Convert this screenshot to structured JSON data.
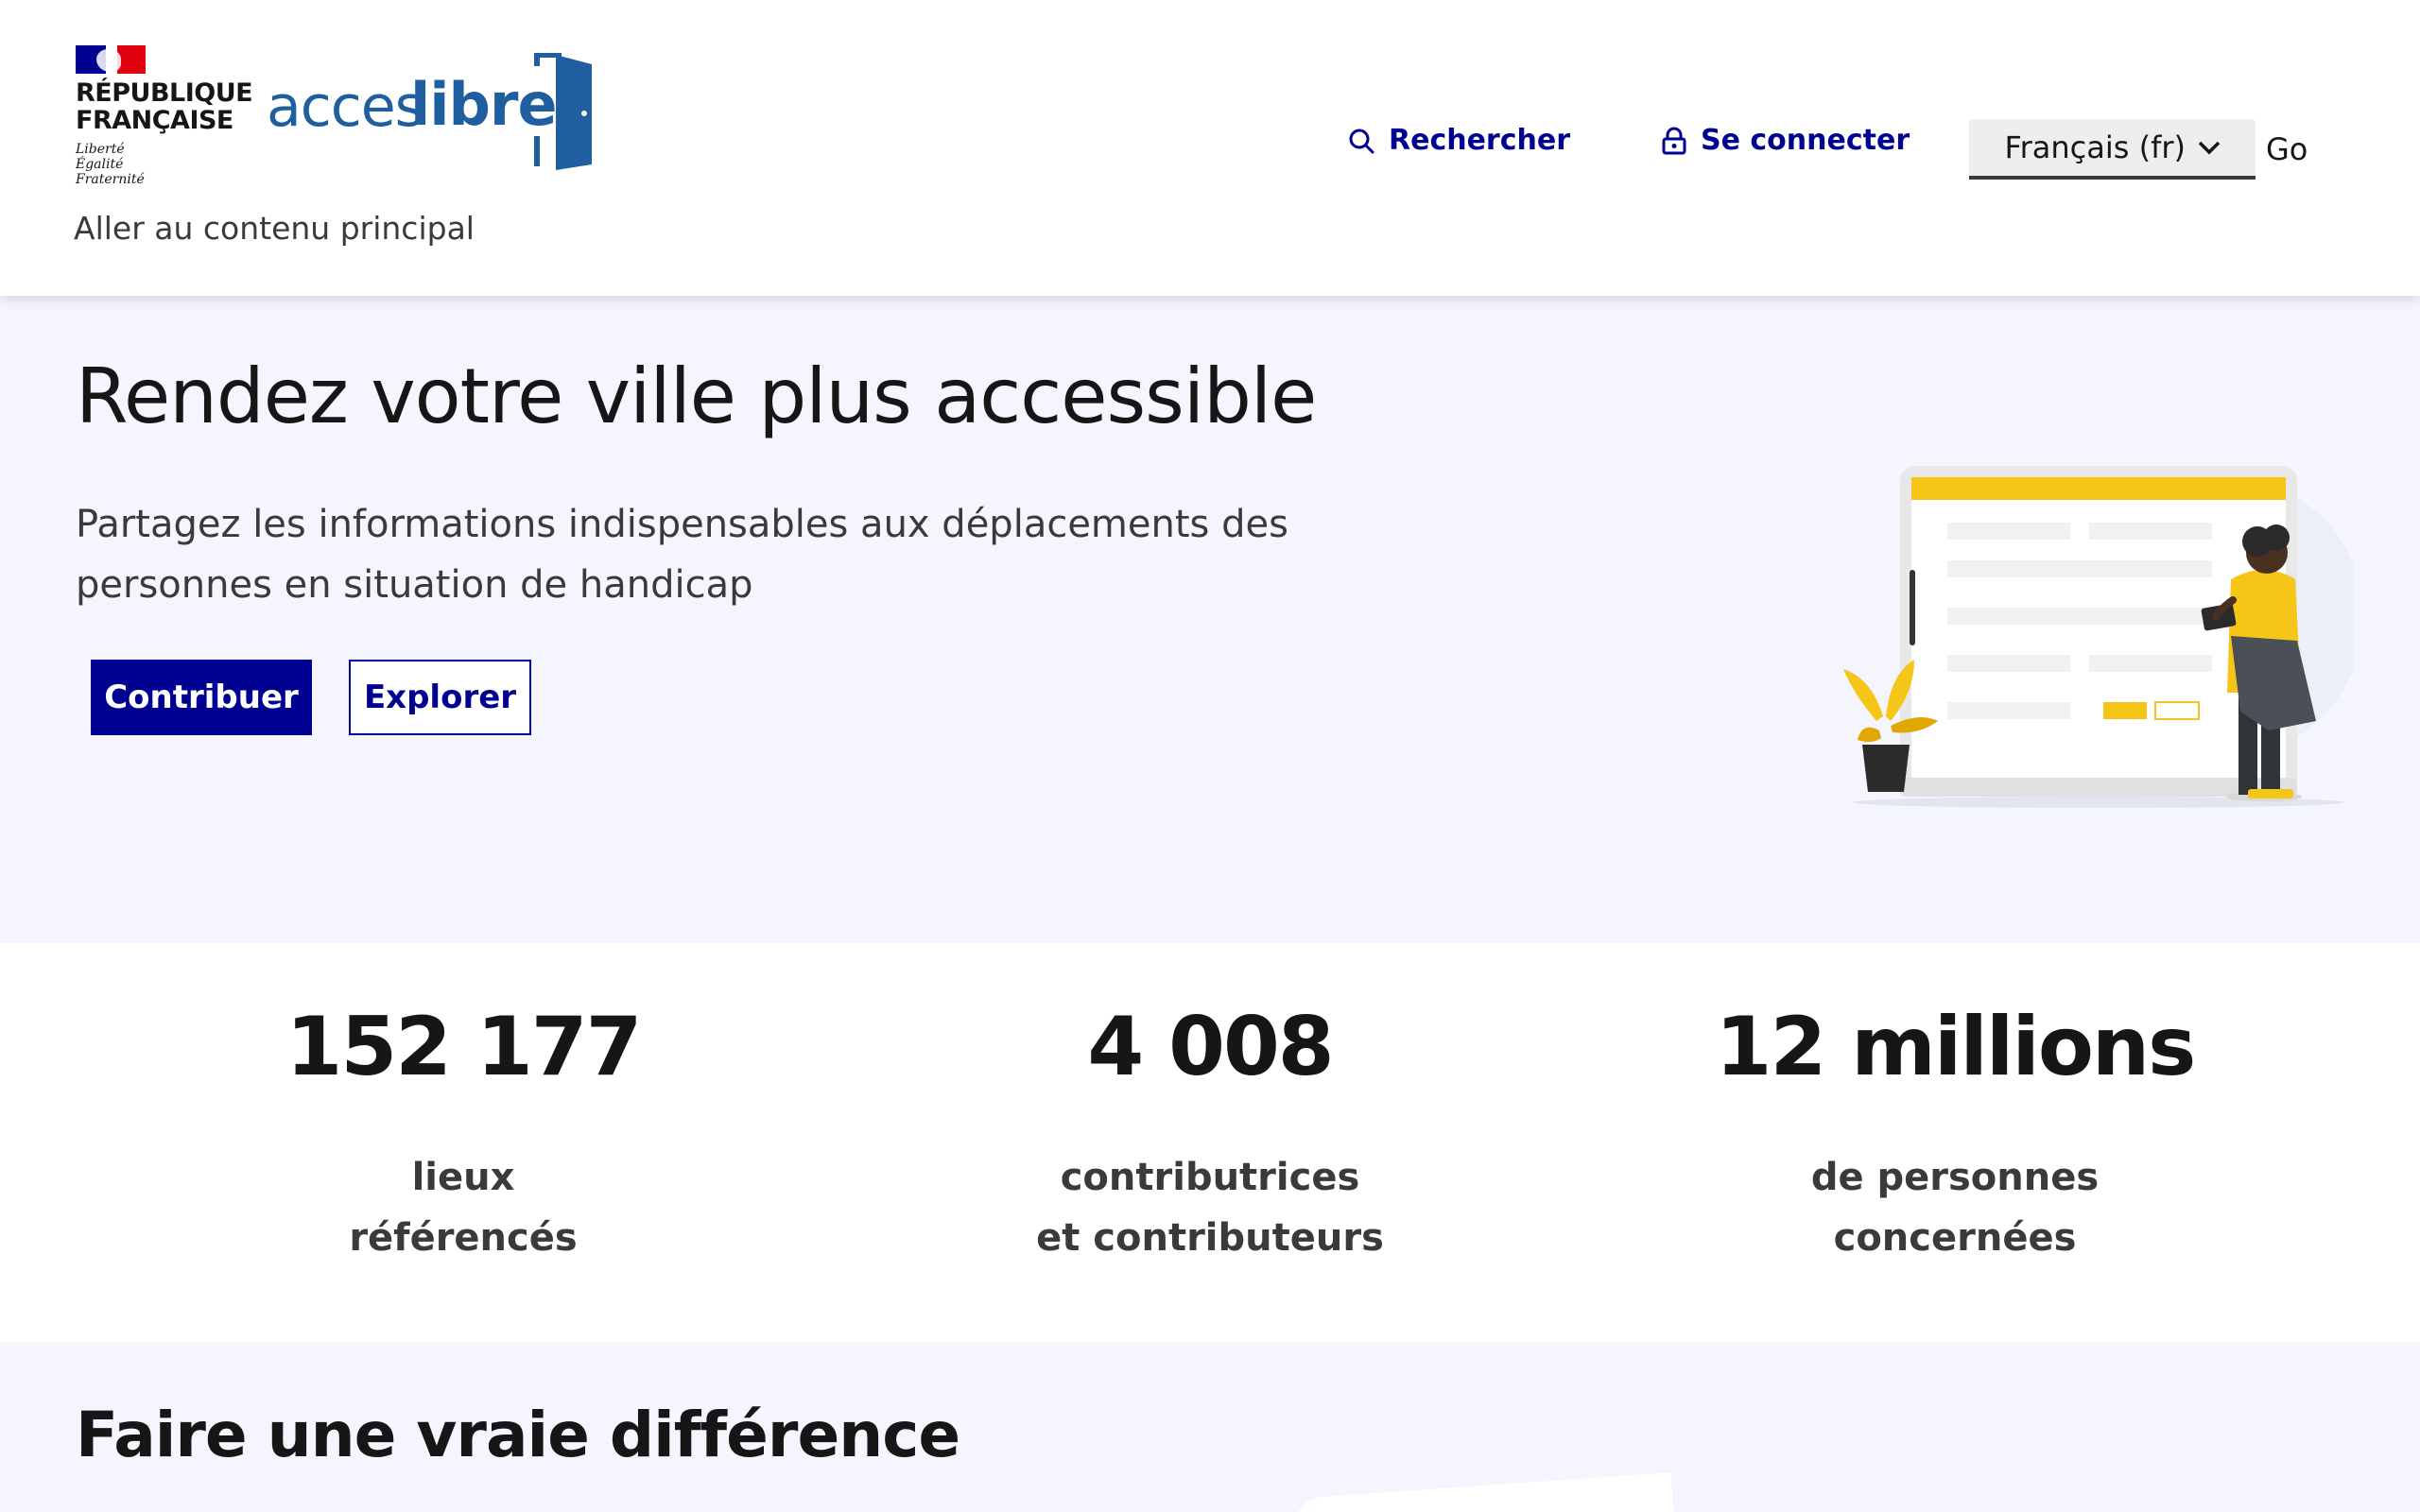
{
  "header": {
    "gov_logo": {
      "name_line1": "RÉPUBLIQUE",
      "name_line2": "FRANÇAISE",
      "motto_line1": "Liberté",
      "motto_line2": "Égalité",
      "motto_line3": "Fraternité"
    },
    "brand_logo": {
      "part1": "acces",
      "part2": "libre"
    },
    "skip_link": "Aller au contenu principal",
    "nav": {
      "search_label": "Rechercher",
      "login_label": "Se connecter"
    },
    "language": {
      "selected": "Français (fr)",
      "go_label": "Go"
    }
  },
  "hero": {
    "title": "Rendez votre ville plus accessible",
    "subtitle": "Partagez les informations indispensables aux déplacements des personnes en situation de handicap",
    "primary_button": "Contribuer",
    "secondary_button": "Explorer"
  },
  "stats": [
    {
      "number": "152 177",
      "label_line1": "lieux",
      "label_line2": "référencés"
    },
    {
      "number": "4 008",
      "label_line1": "contributrices",
      "label_line2": "et contributeurs"
    },
    {
      "number": "12 millions",
      "label_line1": "de personnes",
      "label_line2": "concernées"
    }
  ],
  "difference": {
    "title": "Faire une vraie différence"
  },
  "colors": {
    "primary": "#000091",
    "brand_blue": "#1f5fa0",
    "hero_background": "#f4f5fd",
    "illustration_accent": "#f5c518"
  }
}
